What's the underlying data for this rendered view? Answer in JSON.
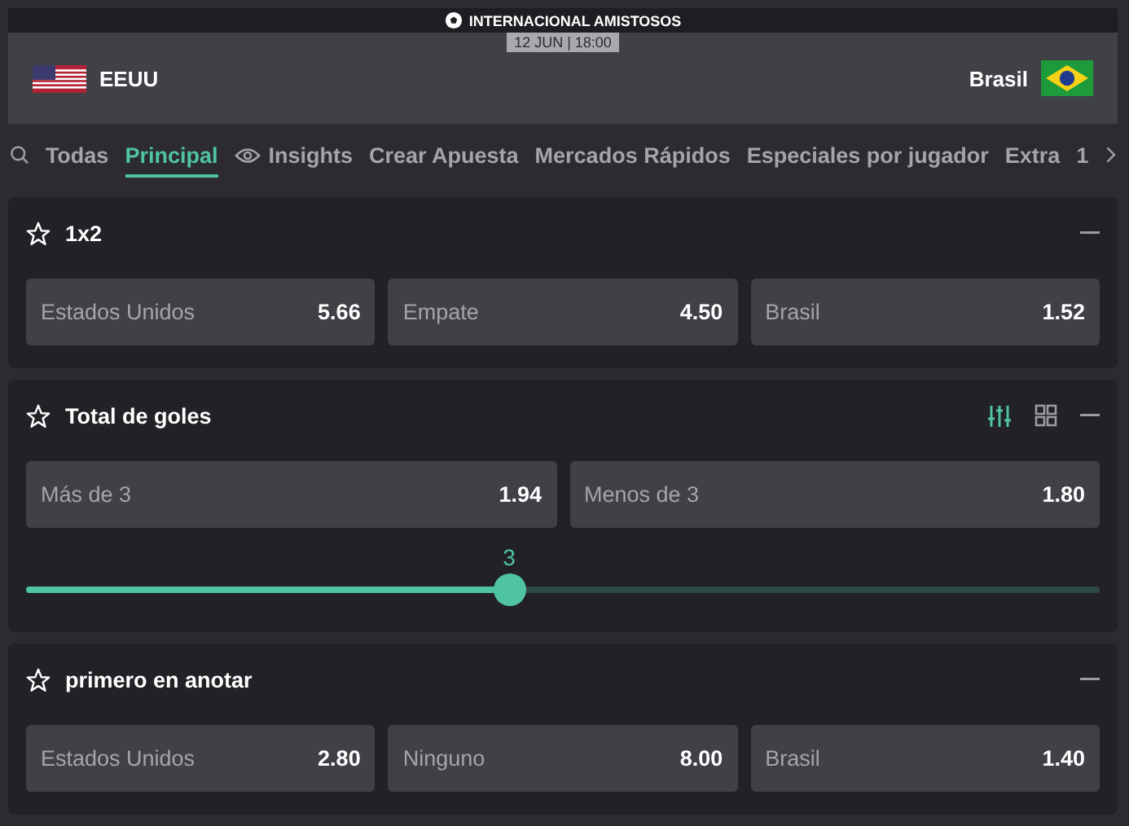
{
  "event": {
    "competition": "INTERNACIONAL AMISTOSOS",
    "time": "12 JUN | 18:00",
    "home": "EEUU",
    "away": "Brasil"
  },
  "tabs": [
    {
      "label": "Todas",
      "selected": false,
      "icon": false
    },
    {
      "label": "Principal",
      "selected": true,
      "icon": false
    },
    {
      "label": "Insights",
      "selected": false,
      "icon": true
    },
    {
      "label": "Crear Apuesta",
      "selected": false,
      "icon": false
    },
    {
      "label": "Mercados Rápidos",
      "selected": false,
      "icon": false
    },
    {
      "label": "Especiales por jugador",
      "selected": false,
      "icon": false
    },
    {
      "label": "Extra",
      "selected": false,
      "icon": false
    },
    {
      "label": "1",
      "selected": false,
      "icon": false
    }
  ],
  "markets": [
    {
      "title": "1x2",
      "kind": "plain",
      "outcomes": [
        {
          "label": "Estados Unidos",
          "odds": "5.66"
        },
        {
          "label": "Empate",
          "odds": "4.50"
        },
        {
          "label": "Brasil",
          "odds": "1.52"
        }
      ]
    },
    {
      "title": "Total de goles",
      "kind": "line",
      "outcomes": [
        {
          "label": "Más de 3",
          "odds": "1.94"
        },
        {
          "label": "Menos de 3",
          "odds": "1.80"
        }
      ],
      "slider": {
        "value": "3",
        "level": 0.45
      }
    },
    {
      "title": "primero en anotar",
      "kind": "plain",
      "outcomes": [
        {
          "label": "Estados Unidos",
          "odds": "2.80"
        },
        {
          "label": "Ninguno",
          "odds": "8.00"
        },
        {
          "label": "Brasil",
          "odds": "1.40"
        }
      ]
    }
  ]
}
